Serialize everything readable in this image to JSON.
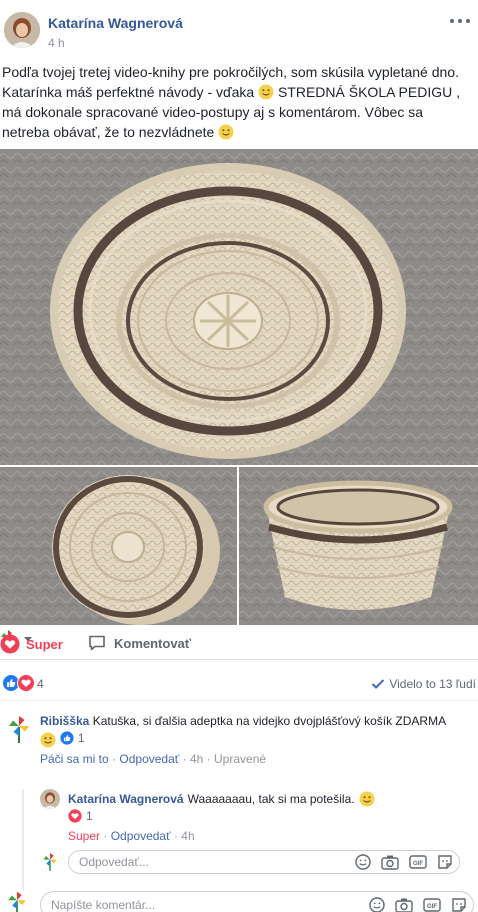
{
  "post": {
    "author": "Katarína Wagnerová",
    "time": "4 h",
    "text_line1": "Podľa tvojej tretej video-knihy pre pokročilých, som skúsila vypletané dno.",
    "text_line2": "Katarínka máš perfektné návody - vďaka",
    "text_line2b": "STREDNÁ ŠKOLA PEDIGU ,",
    "text_line3": "má dokonale spracované video-postupy aj s komentárom. Vôbec sa",
    "text_line4": "netreba obávať, že to nezvládnete"
  },
  "actions": {
    "super_label": "Super",
    "comment_label": "Komentovať"
  },
  "reactions": {
    "count": "4",
    "seen_label": "Videlo to 13 ľudí"
  },
  "comments": [
    {
      "author": "Ribišška",
      "text": "Katuška, si ďalšia adeptka na videjko dvojplášťový košík ZDARMA",
      "like_count": "1",
      "like_label": "Páči sa mi to",
      "reply_label": "Odpovedať",
      "time": "4h",
      "edited_label": "Upravené"
    }
  ],
  "reply": {
    "author": "Katarína Wagnerová",
    "text": "Waaaaaaau, tak si ma potešila.",
    "love_count": "1",
    "super_label": "Super",
    "reply_label": "Odpovedať",
    "time": "4h"
  },
  "reply_input": {
    "placeholder": "Odpovedať..."
  },
  "comment_input": {
    "placeholder": "Napíšte komentár..."
  },
  "separator": "·",
  "colors": {
    "link_blue": "#365899",
    "super_red": "#f33e58",
    "like_blue": "#4267b2",
    "muted": "#90949c"
  }
}
